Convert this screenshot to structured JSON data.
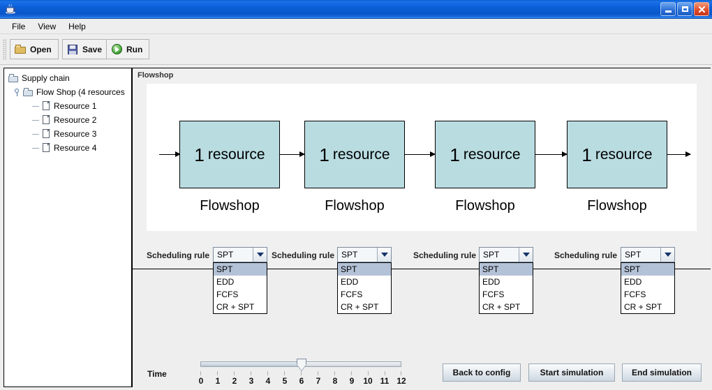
{
  "window": {
    "title": "",
    "app_icon": "java-coffee-cup-icon",
    "controls": {
      "minimize": "minimize-icon",
      "maximize": "maximize-icon",
      "close": "close-icon"
    }
  },
  "menubar": {
    "items": [
      {
        "label": "File"
      },
      {
        "label": "View"
      },
      {
        "label": "Help"
      }
    ]
  },
  "toolbar": {
    "buttons": [
      {
        "label": "Open",
        "icon": "folder-open-icon"
      },
      {
        "label": "Save",
        "icon": "floppy-disk-icon"
      },
      {
        "label": "Run",
        "icon": "play-circle-icon"
      }
    ]
  },
  "sidebar": {
    "tree": [
      {
        "label": "Supply chain",
        "icon": "folder-icon",
        "depth": 0
      },
      {
        "label": "Flow Shop (4 resources",
        "icon": "folder-icon",
        "depth": 1
      },
      {
        "label": "Resource 1",
        "icon": "document-icon",
        "depth": 2
      },
      {
        "label": "Resource 2",
        "icon": "document-icon",
        "depth": 2
      },
      {
        "label": "Resource 3",
        "icon": "document-icon",
        "depth": 2
      },
      {
        "label": "Resource 4",
        "icon": "document-icon",
        "depth": 2
      }
    ]
  },
  "main": {
    "panel_title": "Flowshop",
    "diagram": {
      "node_fill": "#b9dce1",
      "node_border": "#000000",
      "nodes": [
        {
          "count": "1",
          "unit": "resource",
          "caption": "Flowshop"
        },
        {
          "count": "1",
          "unit": "resource",
          "caption": "Flowshop"
        },
        {
          "count": "1",
          "unit": "resource",
          "caption": "Flowshop"
        },
        {
          "count": "1",
          "unit": "resource",
          "caption": "Flowshop"
        }
      ]
    },
    "scheduling": {
      "label": "Scheduling rule",
      "options": [
        "SPT",
        "EDD",
        "FCFS",
        "CR + SPT"
      ],
      "selected": "SPT",
      "controls": [
        {
          "label": "Scheduling rule",
          "value": "SPT",
          "open": true
        },
        {
          "label": "Scheduling rule",
          "value": "SPT",
          "open": true
        },
        {
          "label": "Scheduling rule",
          "value": "SPT",
          "open": true
        },
        {
          "label": "Scheduling rule",
          "value": "SPT",
          "open": true
        }
      ]
    }
  },
  "bottom": {
    "time": {
      "label": "Time",
      "value": 6,
      "min": 0,
      "max": 12,
      "ticks": [
        "0",
        "1",
        "2",
        "3",
        "4",
        "5",
        "6",
        "7",
        "8",
        "9",
        "10",
        "11",
        "12"
      ]
    },
    "buttons": [
      {
        "label": "Back to config"
      },
      {
        "label": "Start simulation"
      },
      {
        "label": "End simulation"
      }
    ]
  }
}
